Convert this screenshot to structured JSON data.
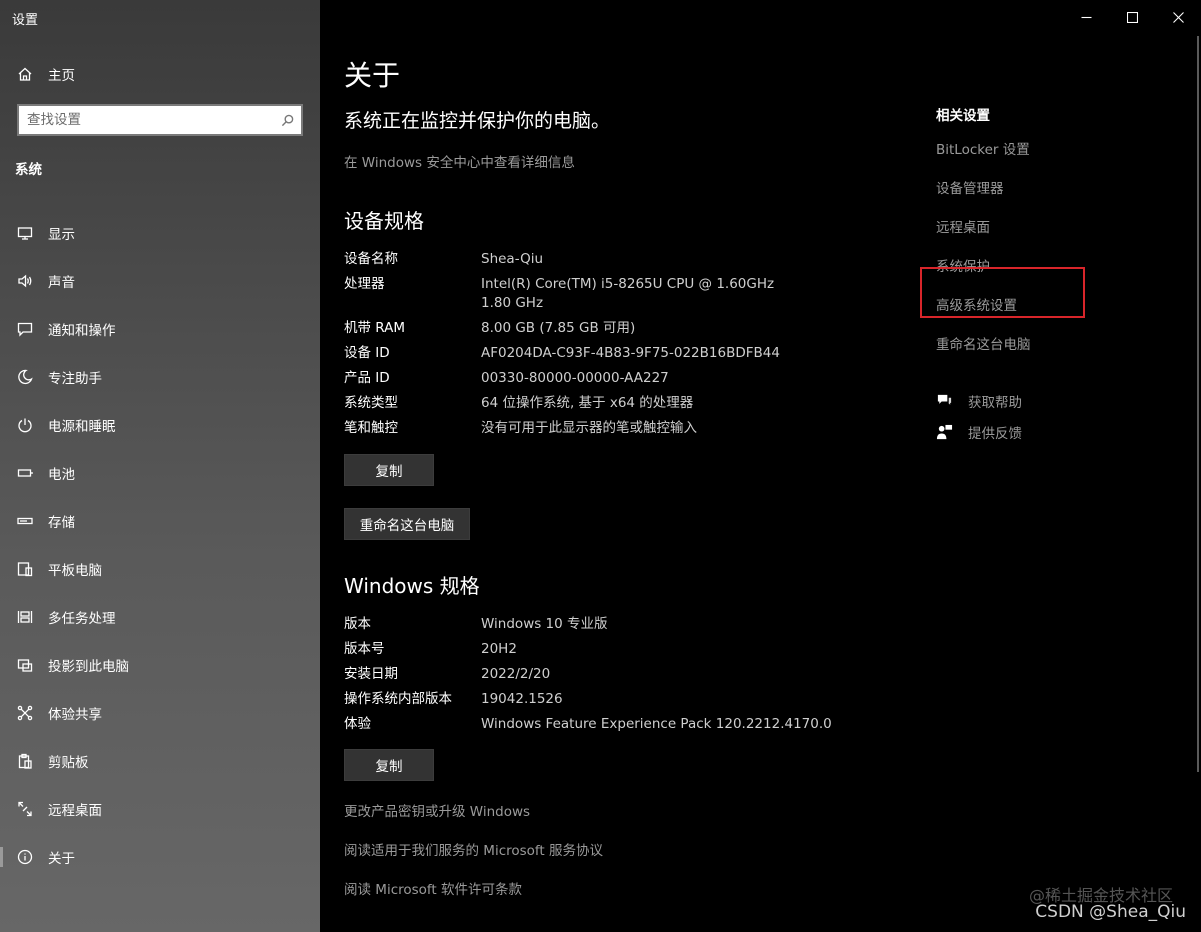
{
  "sidebar": {
    "app_title": "设置",
    "home_label": "主页",
    "search_placeholder": "查找设置",
    "section_title": "系统",
    "items": [
      {
        "label": "显示",
        "icon": "display-icon"
      },
      {
        "label": "声音",
        "icon": "speaker-icon"
      },
      {
        "label": "通知和操作",
        "icon": "notification-icon"
      },
      {
        "label": "专注助手",
        "icon": "moon-icon"
      },
      {
        "label": "电源和睡眠",
        "icon": "power-icon"
      },
      {
        "label": "电池",
        "icon": "battery-icon"
      },
      {
        "label": "存储",
        "icon": "storage-icon"
      },
      {
        "label": "平板电脑",
        "icon": "tablet-icon"
      },
      {
        "label": "多任务处理",
        "icon": "multitask-icon"
      },
      {
        "label": "投影到此电脑",
        "icon": "project-icon"
      },
      {
        "label": "体验共享",
        "icon": "share-icon"
      },
      {
        "label": "剪贴板",
        "icon": "clipboard-icon"
      },
      {
        "label": "远程桌面",
        "icon": "remote-desktop-icon"
      },
      {
        "label": "关于",
        "icon": "info-icon"
      }
    ],
    "selected": "关于"
  },
  "main": {
    "page_title": "关于",
    "protect_text": "系统正在监控并保护你的电脑。",
    "security_link": "在 Windows 安全中心中查看详细信息",
    "device_specs_title": "设备规格",
    "device_specs": [
      {
        "key": "设备名称",
        "value": "Shea-Qiu"
      },
      {
        "key": "处理器",
        "value": "Intel(R) Core(TM) i5-8265U CPU @ 1.60GHz   1.80 GHz"
      },
      {
        "key": "机带 RAM",
        "value": "8.00 GB (7.85 GB 可用)"
      },
      {
        "key": "设备 ID",
        "value": "AF0204DA-C93F-4B83-9F75-022B16BDFB44"
      },
      {
        "key": "产品 ID",
        "value": "00330-80000-00000-AA227"
      },
      {
        "key": "系统类型",
        "value": "64 位操作系统, 基于 x64 的处理器"
      },
      {
        "key": "笔和触控",
        "value": "没有可用于此显示器的笔或触控输入"
      }
    ],
    "copy_label": "复制",
    "rename_label": "重命名这台电脑",
    "windows_specs_title": "Windows 规格",
    "windows_specs": [
      {
        "key": "版本",
        "value": "Windows 10 专业版"
      },
      {
        "key": "版本号",
        "value": "20H2"
      },
      {
        "key": "安装日期",
        "value": "2022/2/20"
      },
      {
        "key": "操作系统内部版本",
        "value": "19042.1526"
      },
      {
        "key": "体验",
        "value": "Windows Feature Experience Pack 120.2212.4170.0"
      }
    ],
    "copy_label2": "复制",
    "bottom_links": [
      "更改产品密钥或升级 Windows",
      "阅读适用于我们服务的 Microsoft 服务协议",
      "阅读 Microsoft 软件许可条款"
    ]
  },
  "related": {
    "title": "相关设置",
    "items": [
      "BitLocker 设置",
      "设备管理器",
      "远程桌面",
      "系统保护",
      "高级系统设置",
      "重命名这台电脑"
    ],
    "highlighted": "高级系统设置",
    "highlight_color": "#d8252a"
  },
  "help": {
    "get_help": "获取帮助",
    "feedback": "提供反馈"
  },
  "watermarks": {
    "line1": "@稀土掘金技术社区",
    "line2": "CSDN @Shea_Qiu"
  }
}
